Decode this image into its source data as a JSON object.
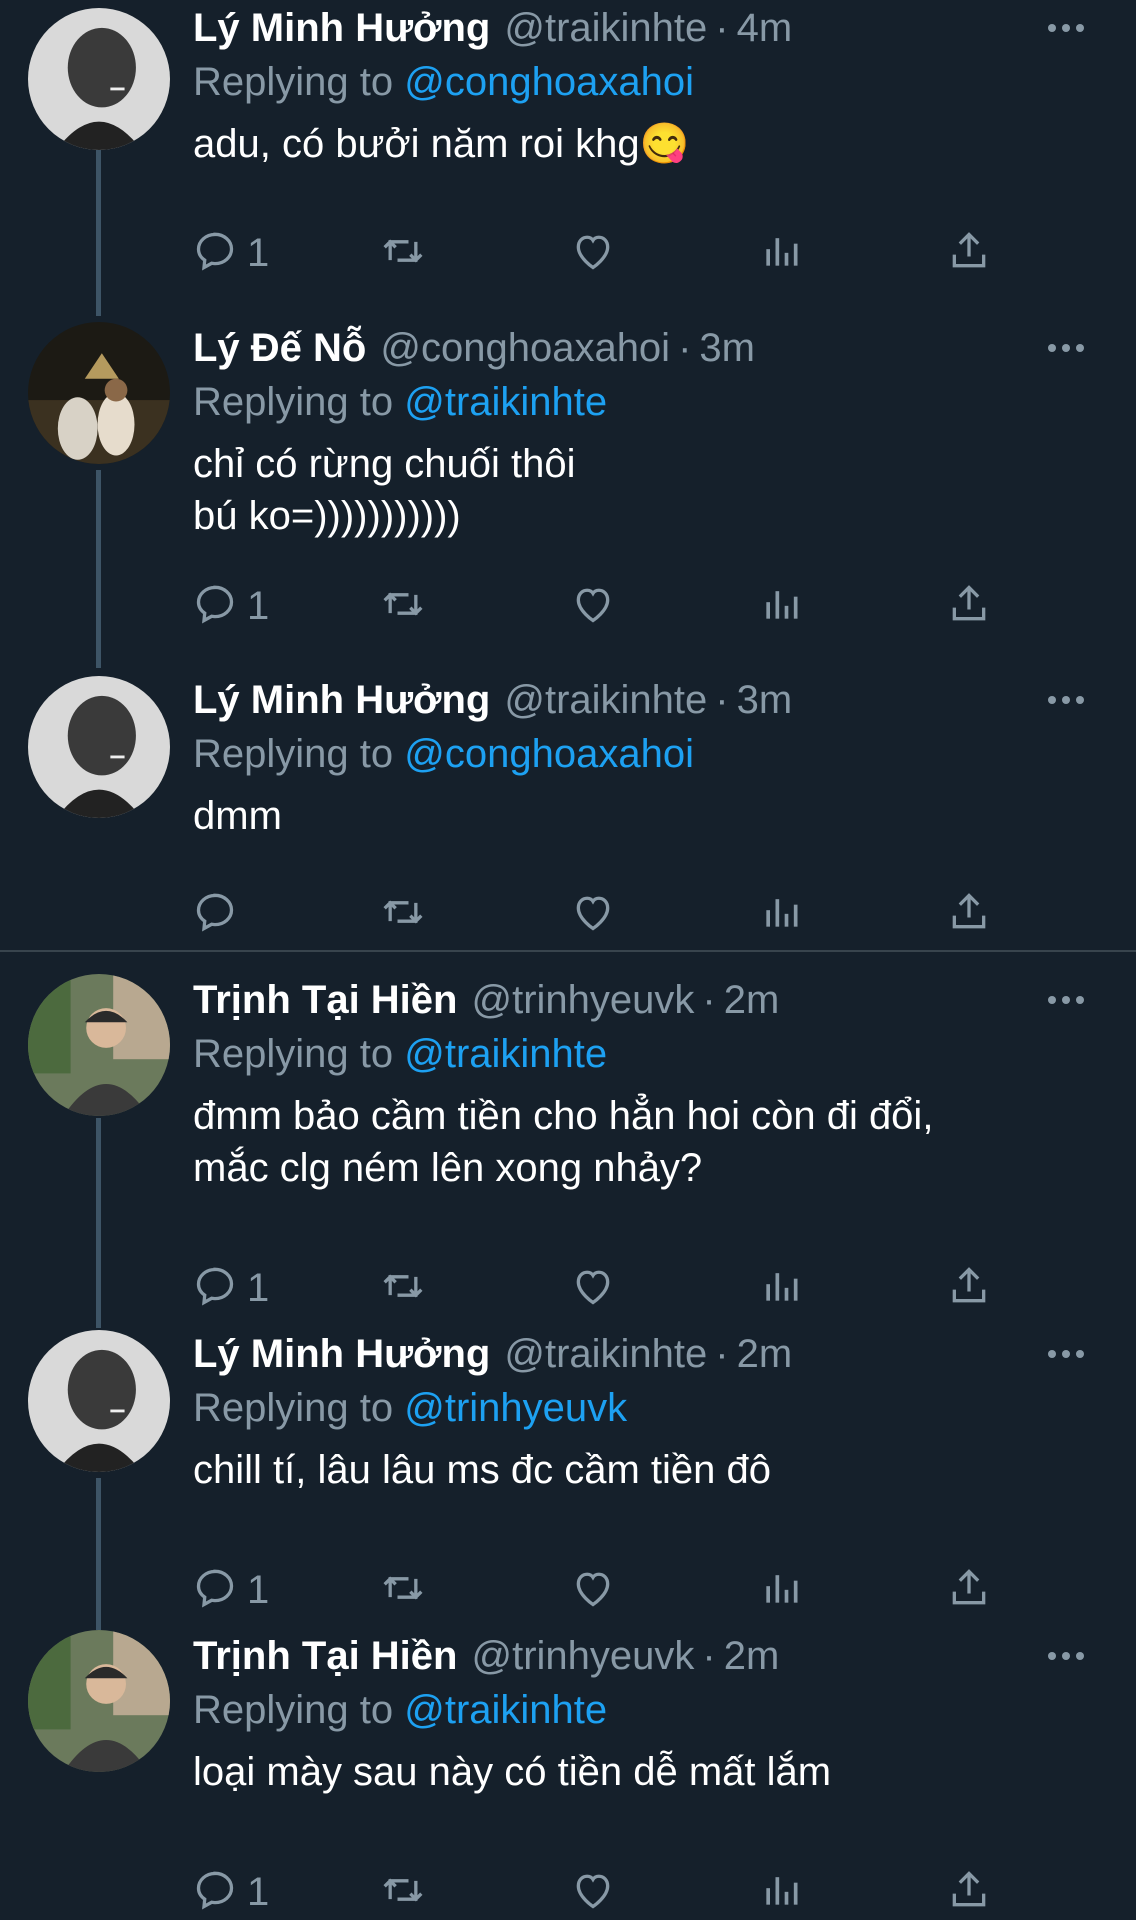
{
  "colors": {
    "background": "#15202b",
    "muted": "#8899a6",
    "link": "#1da1f2",
    "thread_line": "#3d5466"
  },
  "icons": {
    "reply": "reply-icon",
    "retweet": "retweet-icon",
    "like": "heart-icon",
    "analytics": "analytics-icon",
    "share": "share-icon",
    "more": "more-icon"
  },
  "tweets": [
    {
      "name": "Lý Minh Hưởng",
      "handle": "@traikinhte",
      "time": "4m",
      "replying_label": "Replying to",
      "replying_to": "@conghoaxahoi",
      "text": "adu, có bưởi năm roi khg😋",
      "reply_count": "1"
    },
    {
      "name": "Lý Đế Nỗ",
      "handle": "@conghoaxahoi",
      "time": "3m",
      "replying_label": "Replying to",
      "replying_to": "@traikinhte",
      "text": "chỉ có rừng chuối thôi\nbú ko=)))))))))))",
      "reply_count": "1"
    },
    {
      "name": "Lý Minh Hưởng",
      "handle": "@traikinhte",
      "time": "3m",
      "replying_label": "Replying to",
      "replying_to": "@conghoaxahoi",
      "text": "dmm",
      "reply_count": ""
    },
    {
      "name": "Trịnh Tại Hiền",
      "handle": "@trinhyeuvk",
      "time": "2m",
      "replying_label": "Replying to",
      "replying_to": "@traikinhte",
      "text": "đmm bảo cầm tiền cho hẳn hoi còn đi đổi,\nmắc clg ném lên xong nhảy?",
      "reply_count": "1"
    },
    {
      "name": "Lý Minh Hưởng",
      "handle": "@traikinhte",
      "time": "2m",
      "replying_label": "Replying to",
      "replying_to": "@trinhyeuvk",
      "text": "chill tí, lâu lâu ms đc cầm tiền đô",
      "reply_count": "1"
    },
    {
      "name": "Trịnh Tại Hiền",
      "handle": "@trinhyeuvk",
      "time": "2m",
      "replying_label": "Replying to",
      "replying_to": "@traikinhte",
      "text": "loại mày sau này có tiền dễ mất lắm",
      "reply_count": "1"
    }
  ]
}
